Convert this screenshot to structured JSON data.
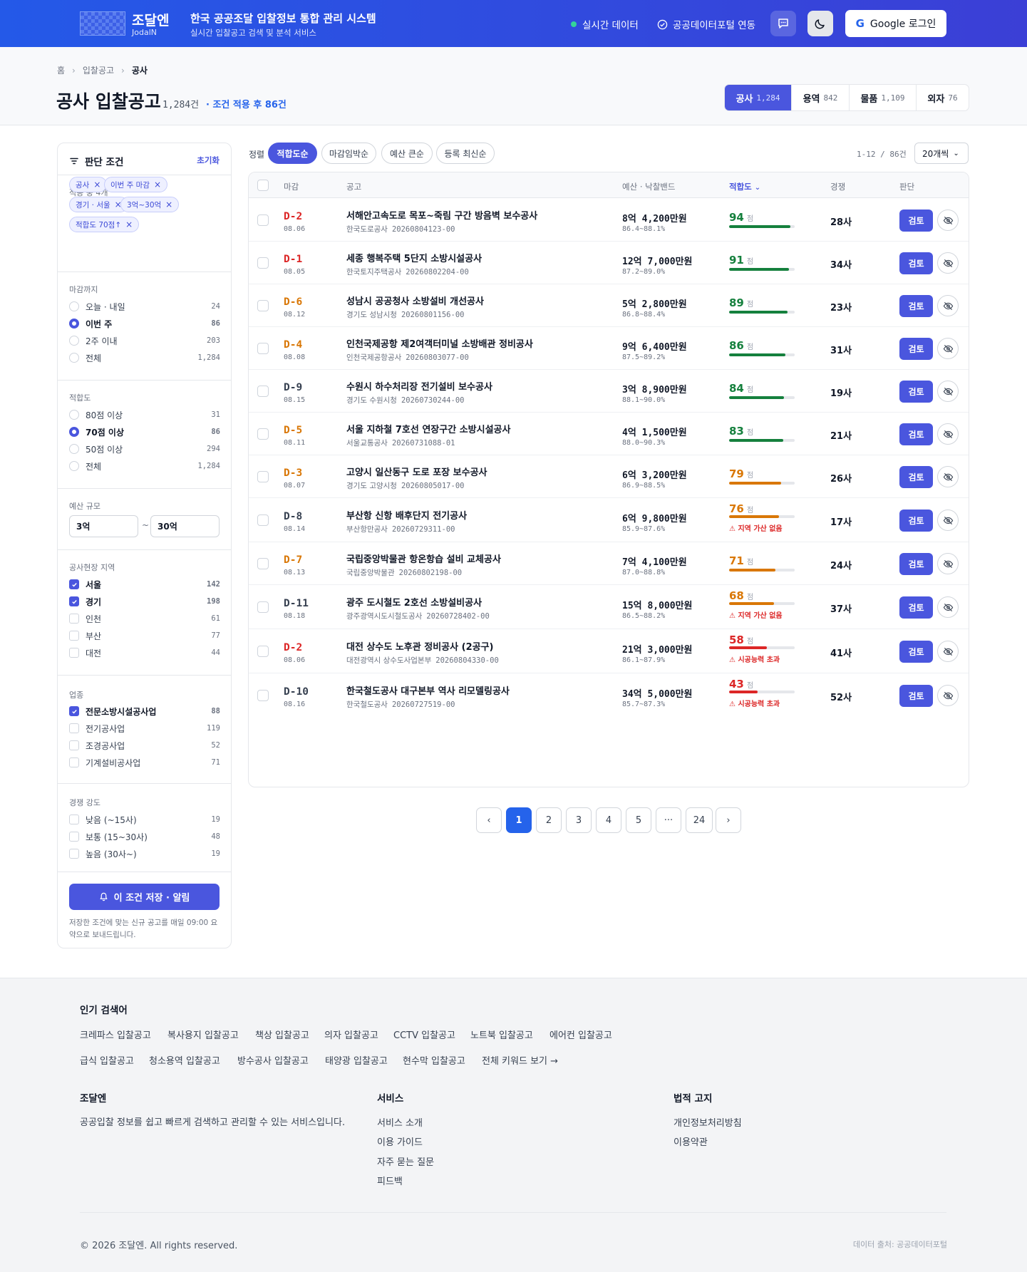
{
  "header": {
    "logo_name": "조달엔",
    "logo_sub": "JodalN",
    "title": "한국 공공조달 입찰정보 통합 관리 시스템",
    "subtitle": "실시간 입찰공고 검색 및 분석 서비스",
    "live_label": "실시간 데이터",
    "portal_label": "공공데이터포털 연동",
    "login_label": "Google 로그인"
  },
  "breadcrumb": [
    "홈",
    "입찰공고",
    "공사"
  ],
  "page": {
    "title": "공사 입찰공고",
    "count": "1,284건",
    "filtered": "· 조건 적용 후 86건"
  },
  "category_tabs": [
    {
      "label": "공사",
      "count": "1,284",
      "active": true
    },
    {
      "label": "용역",
      "count": "842",
      "active": false
    },
    {
      "label": "물품",
      "count": "1,109",
      "active": false
    },
    {
      "label": "외자",
      "count": "76",
      "active": false
    }
  ],
  "sidebar": {
    "title": "판단 조건",
    "reset": "초기화",
    "applied_title": "적용 중 4개",
    "chips": [
      "공사",
      "이번 주 마감",
      "경기 · 서울",
      "3억~30억",
      "적합도 70점↑"
    ],
    "deadline": {
      "title": "마감까지",
      "options": [
        {
          "label": "오늘 · 내일",
          "count": "24",
          "selected": false
        },
        {
          "label": "이번 주",
          "count": "86",
          "selected": true
        },
        {
          "label": "2주 이내",
          "count": "203",
          "selected": false
        },
        {
          "label": "전체",
          "count": "1,284",
          "selected": false
        }
      ]
    },
    "fitness": {
      "title": "적합도",
      "options": [
        {
          "label": "80점 이상",
          "count": "31",
          "selected": false
        },
        {
          "label": "70점 이상",
          "count": "86",
          "selected": true
        },
        {
          "label": "50점 이상",
          "count": "294",
          "selected": false
        },
        {
          "label": "전체",
          "count": "1,284",
          "selected": false
        }
      ]
    },
    "budget": {
      "title": "예산 규모",
      "min": "3억",
      "sep": "~",
      "max": "30억"
    },
    "region": {
      "title": "공사현장 지역",
      "options": [
        {
          "label": "서울",
          "count": "142",
          "checked": true
        },
        {
          "label": "경기",
          "count": "198",
          "checked": true
        },
        {
          "label": "인천",
          "count": "61",
          "checked": false
        },
        {
          "label": "부산",
          "count": "77",
          "checked": false
        },
        {
          "label": "대전",
          "count": "44",
          "checked": false
        }
      ]
    },
    "industry": {
      "title": "업종",
      "options": [
        {
          "label": "전문소방시설공사업",
          "count": "88",
          "checked": true
        },
        {
          "label": "전기공사업",
          "count": "119",
          "checked": false
        },
        {
          "label": "조경공사업",
          "count": "52",
          "checked": false
        },
        {
          "label": "기계설비공사업",
          "count": "71",
          "checked": false
        }
      ]
    },
    "competition": {
      "title": "경쟁 강도",
      "options": [
        {
          "label": "낮음 (~15사)",
          "count": "19",
          "checked": false
        },
        {
          "label": "보통 (15~30사)",
          "count": "48",
          "checked": false
        },
        {
          "label": "높음 (30사~)",
          "count": "19",
          "checked": false
        }
      ]
    },
    "save_button": "이 조건 저장 · 알림",
    "save_note": "저장한 조건에 맞는 신규 공고를 매일 09:00 요약으로 보내드립니다."
  },
  "sort": {
    "label": "정렬",
    "options": [
      {
        "label": "적합도순",
        "active": true
      },
      {
        "label": "마감임박순",
        "active": false
      },
      {
        "label": "예산 큰순",
        "active": false
      },
      {
        "label": "등록 최신순",
        "active": false
      }
    ],
    "range": "1-12 / 86건",
    "per_page": "20개씩"
  },
  "table": {
    "columns": [
      "마감",
      "공고",
      "예산 · 낙찰밴드",
      "적합도",
      "경쟁",
      "판단"
    ],
    "review_label": "검토",
    "score_unit": "점",
    "rows": [
      {
        "dday": "D-2",
        "date": "08.06",
        "urgency": "red",
        "title": "서해안고속도로 목포~죽림 구간 방음벽 보수공사",
        "agency": "한국도로공사",
        "notice_no": "20260804123-00",
        "budget": "8억 4,200만원",
        "band": "86.4~88.1%",
        "score": 94,
        "warning": "",
        "competitors": "28사"
      },
      {
        "dday": "D-1",
        "date": "08.05",
        "urgency": "red",
        "title": "세종 행복주택 5단지 소방시설공사",
        "agency": "한국토지주택공사",
        "notice_no": "20260802204-00",
        "budget": "12억 7,000만원",
        "band": "87.2~89.0%",
        "score": 91,
        "warning": "",
        "competitors": "34사"
      },
      {
        "dday": "D-6",
        "date": "08.12",
        "urgency": "orange",
        "title": "성남시 공공청사 소방설비 개선공사",
        "agency": "경기도 성남시청",
        "notice_no": "20260801156-00",
        "budget": "5억 2,800만원",
        "band": "86.8~88.4%",
        "score": 89,
        "warning": "",
        "competitors": "23사"
      },
      {
        "dday": "D-4",
        "date": "08.08",
        "urgency": "orange",
        "title": "인천국제공항 제2여객터미널 소방배관 정비공사",
        "agency": "인천국제공항공사",
        "notice_no": "20260803077-00",
        "budget": "9억 6,400만원",
        "band": "87.5~89.2%",
        "score": 86,
        "warning": "",
        "competitors": "31사"
      },
      {
        "dday": "D-9",
        "date": "08.15",
        "urgency": "gray",
        "title": "수원시 하수처리장 전기설비 보수공사",
        "agency": "경기도 수원시청",
        "notice_no": "20260730244-00",
        "budget": "3억 8,900만원",
        "band": "88.1~90.0%",
        "score": 84,
        "warning": "",
        "competitors": "19사"
      },
      {
        "dday": "D-5",
        "date": "08.11",
        "urgency": "orange",
        "title": "서울 지하철 7호선 연장구간 소방시설공사",
        "agency": "서울교통공사",
        "notice_no": "20260731088-01",
        "budget": "4억 1,500만원",
        "band": "88.0~90.3%",
        "score": 83,
        "warning": "",
        "competitors": "21사"
      },
      {
        "dday": "D-3",
        "date": "08.07",
        "urgency": "orange",
        "title": "고양시 일산동구 도로 포장 보수공사",
        "agency": "경기도 고양시청",
        "notice_no": "20260805017-00",
        "budget": "6억 3,200만원",
        "band": "86.9~88.5%",
        "score": 79,
        "warning": "",
        "competitors": "26사"
      },
      {
        "dday": "D-8",
        "date": "08.14",
        "urgency": "gray",
        "title": "부산항 신항 배후단지 전기공사",
        "agency": "부산항만공사",
        "notice_no": "20260729311-00",
        "budget": "6억 9,800만원",
        "band": "85.9~87.6%",
        "score": 76,
        "warning": "지역 가산 없음",
        "competitors": "17사"
      },
      {
        "dday": "D-7",
        "date": "08.13",
        "urgency": "orange",
        "title": "국립중앙박물관 항온항습 설비 교체공사",
        "agency": "국립중앙박물관",
        "notice_no": "20260802198-00",
        "budget": "7억 4,100만원",
        "band": "87.0~88.8%",
        "score": 71,
        "warning": "",
        "competitors": "24사"
      },
      {
        "dday": "D-11",
        "date": "08.18",
        "urgency": "gray",
        "title": "광주 도시철도 2호선 소방설비공사",
        "agency": "광주광역시도시철도공사",
        "notice_no": "20260728402-00",
        "budget": "15억 8,000만원",
        "band": "86.5~88.2%",
        "score": 68,
        "warning": "지역 가산 없음",
        "competitors": "37사"
      },
      {
        "dday": "D-2",
        "date": "08.06",
        "urgency": "red",
        "title": "대전 상수도 노후관 정비공사 (2공구)",
        "agency": "대전광역시 상수도사업본부",
        "notice_no": "20260804330-00",
        "budget": "21억 3,000만원",
        "band": "86.1~87.9%",
        "score": 58,
        "warning": "시공능력 초과",
        "competitors": "41사"
      },
      {
        "dday": "D-10",
        "date": "08.16",
        "urgency": "gray",
        "title": "한국철도공사 대구본부 역사 리모델링공사",
        "agency": "한국철도공사",
        "notice_no": "20260727519-00",
        "budget": "34억 5,000만원",
        "band": "85.7~87.3%",
        "score": 43,
        "warning": "시공능력 초과",
        "competitors": "52사"
      }
    ]
  },
  "pagination": {
    "prev": "‹",
    "pages": [
      "1",
      "2",
      "3",
      "4",
      "5",
      "···",
      "24"
    ],
    "current": "1",
    "next": "›"
  },
  "footer": {
    "popular_title": "인기 검색어",
    "keywords_row1": [
      "크레파스 입찰공고",
      "복사용지 입찰공고",
      "책상 입찰공고",
      "의자 입찰공고",
      "CCTV 입찰공고",
      "노트북 입찰공고",
      "에어컨 입찰공고"
    ],
    "keywords_row2": [
      "급식 입찰공고",
      "청소용역 입찰공고",
      "방수공사 입찰공고",
      "태양광 입찰공고",
      "현수막 입찰공고",
      "전체 키워드 보기 →"
    ],
    "brand_title": "조달엔",
    "brand_desc": "공공입찰 정보를 쉽고 빠르게 검색하고 관리할 수 있는 서비스입니다.",
    "service_title": "서비스",
    "service_links": [
      "서비스 소개",
      "이용 가이드",
      "자주 묻는 질문",
      "피드백"
    ],
    "legal_title": "법적 고지",
    "legal_links": [
      "개인정보처리방침",
      "이용약관"
    ],
    "copyright": "© 2026 조달엔. All rights reserved.",
    "source": "데이터 출처: 공공데이터포털"
  },
  "colors": {
    "primary": "#4a56de",
    "header_start": "#2459e8",
    "header_end": "#3b3fd6",
    "urgent_red": "#dc2626",
    "urgent_orange": "#d97706",
    "score_green": "#15803d",
    "score_orange": "#d97706",
    "score_red": "#dc2626"
  }
}
